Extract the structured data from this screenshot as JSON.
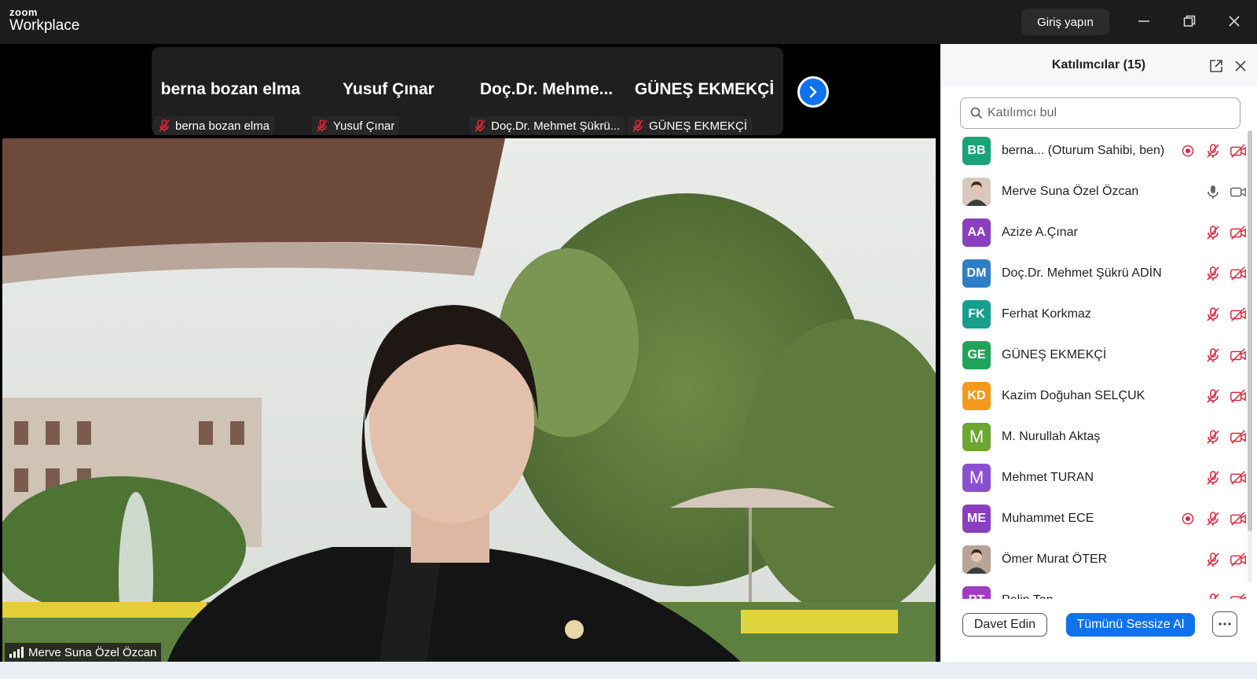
{
  "app": {
    "logo_top": "zoom",
    "logo_bottom": "Workplace",
    "signin_label": "Giriş yapın"
  },
  "gallery": {
    "tiles": [
      {
        "name": "berna bozan elma",
        "label": "berna bozan elma"
      },
      {
        "name": "Yusuf Çınar",
        "label": "Yusuf Çınar"
      },
      {
        "name": "Doç.Dr.  Mehme...",
        "label": "Doç.Dr. Mehmet Şükrü..."
      },
      {
        "name": "GÜNEŞ EKMEKÇİ",
        "label": "GÜNEŞ EKMEKÇİ"
      }
    ]
  },
  "video": {
    "speaker_label": "Merve Suna Özel Özcan"
  },
  "panel": {
    "title": "Katılımcılar (15)",
    "search_placeholder": "Katılımcı bul",
    "participants": [
      {
        "initials": "BB",
        "name": "berna... (Oturum Sahibi, ben)",
        "color": "#1aa376",
        "recording": true,
        "muted": true,
        "video_off": true
      },
      {
        "initials": "",
        "name": "Merve Suna Özel Özcan",
        "color": "#d8c8bd",
        "photo": true,
        "recording": false,
        "muted": false,
        "video_off": false
      },
      {
        "initials": "AA",
        "name": "Azize A.Çınar",
        "color": "#8a3fbf",
        "recording": false,
        "muted": true,
        "video_off": true
      },
      {
        "initials": "DM",
        "name": "Doç.Dr. Mehmet Şükrü ADİN",
        "color": "#2f7fc4",
        "recording": false,
        "muted": true,
        "video_off": true
      },
      {
        "initials": "FK",
        "name": "Ferhat Korkmaz",
        "color": "#159f8c",
        "recording": false,
        "muted": true,
        "video_off": true
      },
      {
        "initials": "GE",
        "name": "GÜNEŞ EKMEKÇİ",
        "color": "#22a35a",
        "recording": false,
        "muted": true,
        "video_off": true
      },
      {
        "initials": "KD",
        "name": "Kazim Doğuhan SELÇUK",
        "color": "#f39a1c",
        "recording": false,
        "muted": true,
        "video_off": true
      },
      {
        "initials": "M",
        "name": "M. Nurullah Aktaş",
        "color": "#6aa630",
        "recording": false,
        "muted": true,
        "video_off": true
      },
      {
        "initials": "M",
        "name": "Mehmet TURAN",
        "color": "#8a4fd0",
        "recording": false,
        "muted": true,
        "video_off": true
      },
      {
        "initials": "ME",
        "name": "Muhammet ECE",
        "color": "#8a3fbf",
        "recording": true,
        "muted": true,
        "video_off": true
      },
      {
        "initials": "",
        "name": "Ömer Murat ÖTER",
        "color": "#b8a494",
        "photo": true,
        "recording": false,
        "muted": true,
        "video_off": true
      },
      {
        "initials": "PT",
        "name": "Pelin Tan",
        "color": "#a33bc2",
        "recording": false,
        "muted": true,
        "video_off": true
      }
    ],
    "invite_label": "Davet Edin",
    "mute_all_label": "Tümünü Sessize Al"
  },
  "colors": {
    "accent": "#0e72ed",
    "muted_red": "#e0263a"
  },
  "icons": [
    "minimize-icon",
    "restore-icon",
    "close-icon",
    "chevron-right-icon",
    "search-icon",
    "popout-icon",
    "mic-off-icon",
    "video-off-icon",
    "mic-icon",
    "video-icon",
    "recording-icon",
    "more-icon",
    "signal-icon"
  ]
}
